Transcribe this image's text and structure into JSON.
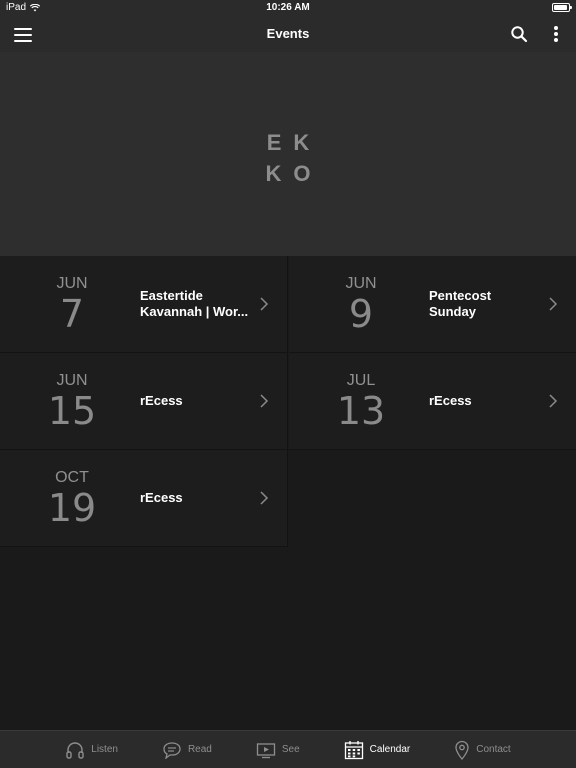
{
  "status_bar": {
    "device": "iPad",
    "time": "10:26 AM",
    "battery_level": 0.9
  },
  "nav": {
    "title": "Events",
    "icons": [
      "menu-icon",
      "search-icon",
      "more-vertical-icon"
    ]
  },
  "hero": {
    "logo_line1": "EK",
    "logo_line2": "KO"
  },
  "events": [
    {
      "month": "JUN",
      "day": "7",
      "title_line1": "Eastertide",
      "title_line2": "Kavannah | Wor..."
    },
    {
      "month": "JUN",
      "day": "9",
      "title_line1": "Pentecost",
      "title_line2": "Sunday"
    },
    {
      "month": "JUN",
      "day": "15",
      "title_line1": "rEcess",
      "title_line2": ""
    },
    {
      "month": "JUL",
      "day": "13",
      "title_line1": "rEcess",
      "title_line2": ""
    },
    {
      "month": "OCT",
      "day": "19",
      "title_line1": "rEcess",
      "title_line2": ""
    }
  ],
  "tabs": [
    {
      "label": "Listen",
      "icon": "headphones-icon",
      "active": false
    },
    {
      "label": "Read",
      "icon": "chat-bubble-icon",
      "active": false
    },
    {
      "label": "See",
      "icon": "video-icon",
      "active": false
    },
    {
      "label": "Calendar",
      "icon": "calendar-icon",
      "active": true
    },
    {
      "label": "Contact",
      "icon": "location-pin-icon",
      "active": false
    }
  ],
  "colors": {
    "background": "#1a1a1b",
    "bar": "#2b2b2c",
    "hero": "#2e2e2e",
    "card": "#1d1d1e",
    "date_text": "#909090",
    "logo": "#8d8d8d"
  }
}
